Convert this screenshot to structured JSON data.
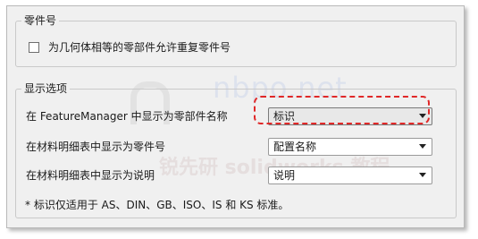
{
  "part_number_group": {
    "legend": "零件号",
    "checkbox_label": "为几何体相等的零部件允许重复零件号",
    "checkbox_checked": false
  },
  "display_group": {
    "legend": "显示选项",
    "rows": [
      {
        "label": "在 FeatureManager 中显示为零部件名称",
        "value": "标识"
      },
      {
        "label": "在材料明细表中显示为零件号",
        "value": "配置名称"
      },
      {
        "label": "在材料明细表中显示为说明",
        "value": "说明"
      }
    ],
    "note": "* 标识仅适用于 AS、DIN、GB、ISO、IS 和 KS 标准。"
  },
  "watermark": {
    "site": "nbpo.net",
    "text": "锐先研 solidworks 教程"
  },
  "colors": {
    "highlight_dash": "#e02828",
    "panel_bg": "#f0f0f0"
  }
}
